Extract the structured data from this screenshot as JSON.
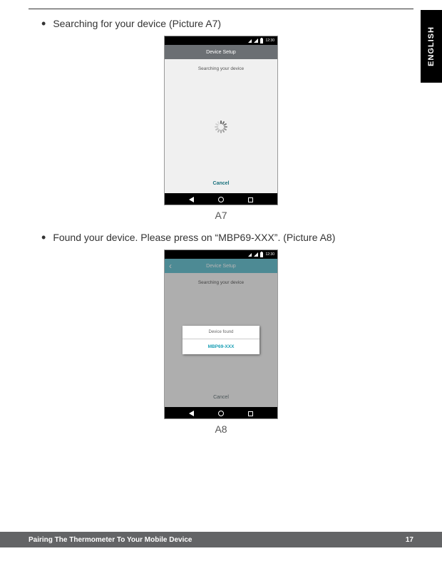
{
  "language_tab": "ENGLISH",
  "bullets": {
    "a7": "Searching for your device (Picture A7)",
    "a8": "Found your device. Please press on “MBP69-XXX”. (Picture A8)"
  },
  "captions": {
    "a7": "A7",
    "a8": "A8"
  },
  "phone": {
    "status_time": "12:30",
    "header_title": "Device Setup",
    "searching_text": "Searching your device",
    "cancel_label": "Cancel",
    "dialog_title": "Device found",
    "dialog_item": "MBP69-XXX"
  },
  "footer": {
    "title": "Pairing The Thermometer To Your Mobile Device",
    "page": "17"
  }
}
